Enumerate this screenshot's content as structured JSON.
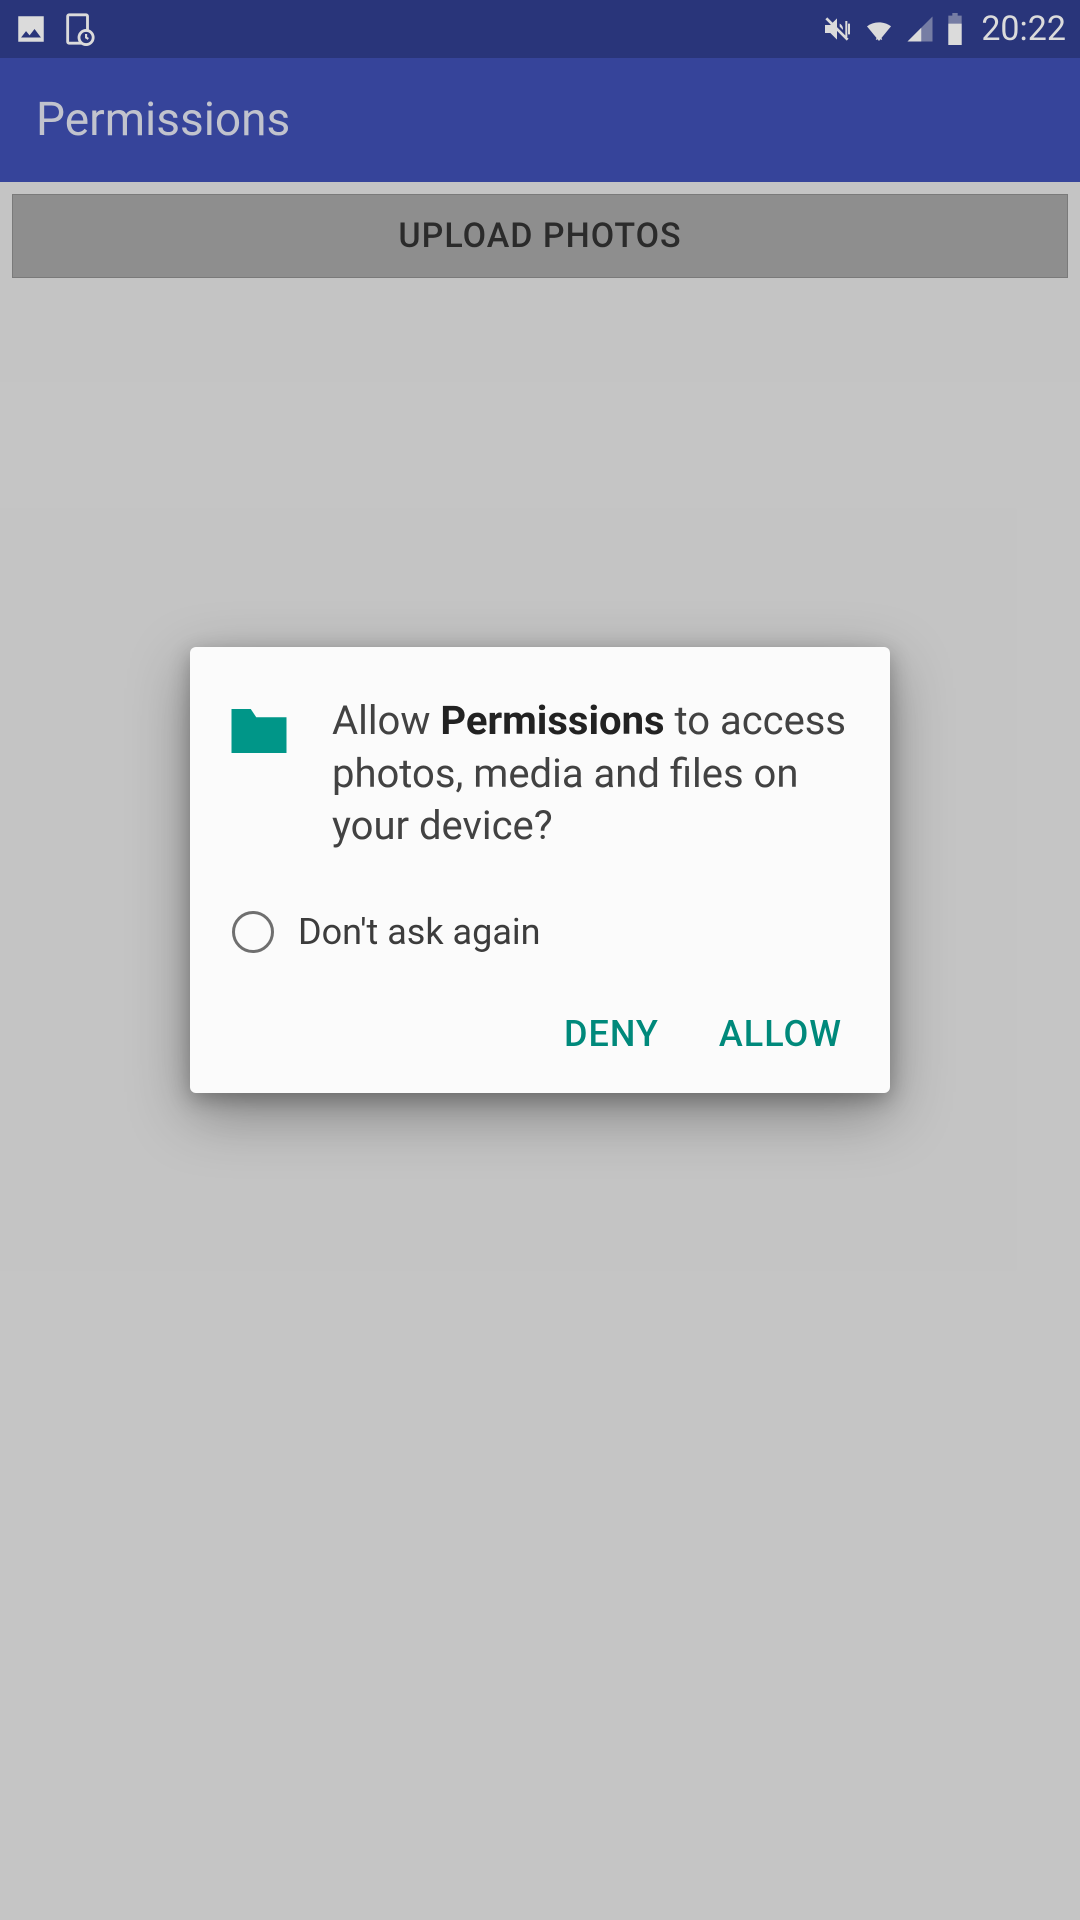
{
  "status_bar": {
    "time": "20:22"
  },
  "app_bar": {
    "title": "Permissions"
  },
  "main": {
    "upload_button": "UPLOAD PHOTOS"
  },
  "dialog": {
    "text_prefix": "Allow ",
    "app_name": "Permissions",
    "text_suffix": " to access photos, media and files on your device?",
    "dont_ask_again": "Don't ask again",
    "deny": "DENY",
    "allow": "ALLOW"
  },
  "colors": {
    "accent_teal": "#00897b",
    "primary": "#3f50b4",
    "primary_dark": "#303e8f"
  }
}
